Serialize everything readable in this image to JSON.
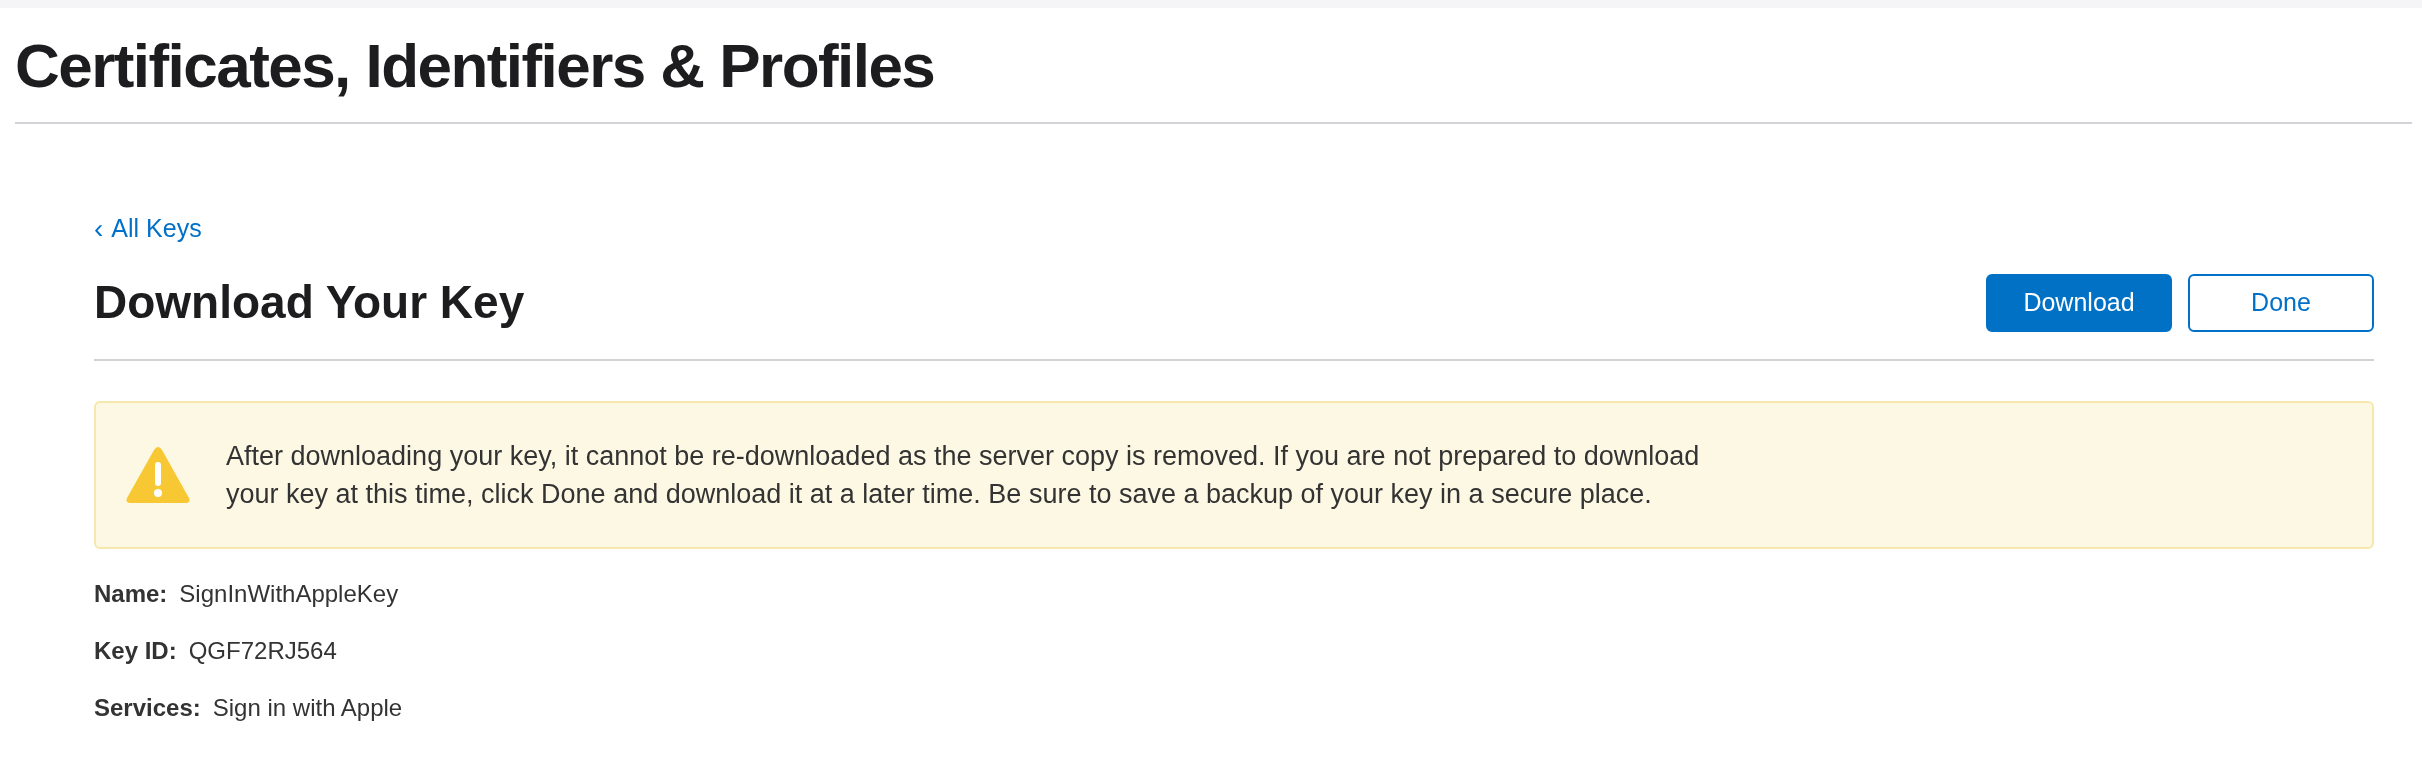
{
  "header": {
    "title": "Certificates, Identifiers & Profiles"
  },
  "back_link": {
    "icon": "‹",
    "label": "All Keys"
  },
  "page_title": "Download Your Key",
  "buttons": [
    {
      "label": "Download",
      "kind": "primary"
    },
    {
      "label": "Done",
      "kind": "secondary"
    }
  ],
  "warning": {
    "lines": [
      "After downloading your key, it cannot be re-downloaded as the server copy is removed. If you are not prepared to download",
      "your key at this time, click Done and download it at a later time. Be sure to save a backup of your key in a secure place."
    ]
  },
  "details": [
    {
      "label": "Name:",
      "value": "SignInWithAppleKey"
    },
    {
      "label": "Key ID:",
      "value": "QGF72RJ564"
    },
    {
      "label": "Services:",
      "value": "Sign in with Apple"
    }
  ]
}
